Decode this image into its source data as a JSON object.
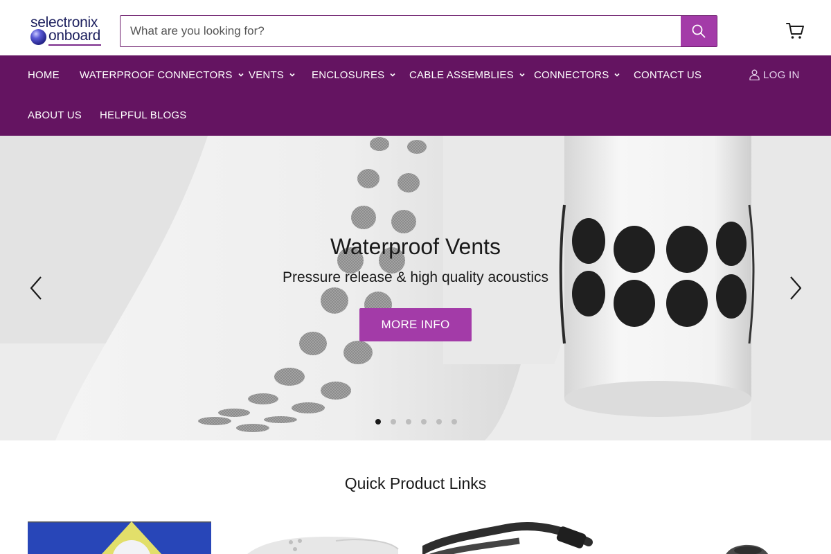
{
  "header": {
    "logo_top": "selectronix",
    "logo_bottom": "onboard",
    "search_placeholder": "What are you looking for?"
  },
  "nav": {
    "row1": [
      {
        "label": "HOME",
        "dropdown": false
      },
      {
        "label": "WATERPROOF CONNECTORS",
        "dropdown": true
      },
      {
        "label": "VENTS",
        "dropdown": true
      },
      {
        "label": "ENCLOSURES",
        "dropdown": true
      },
      {
        "label": "CABLE ASSEMBLIES",
        "dropdown": true
      },
      {
        "label": "CONNECTORS",
        "dropdown": true
      },
      {
        "label": "CONTACT US",
        "dropdown": false
      }
    ],
    "row2": [
      {
        "label": "ABOUT US",
        "dropdown": false
      },
      {
        "label": "HELPFUL BLOGS",
        "dropdown": false
      }
    ],
    "login_label": "LOG IN"
  },
  "hero": {
    "title": "Waterproof Vents",
    "subtitle": "Pressure release & high quality acoustics",
    "button_label": "MORE INFO",
    "slide_count": 6,
    "active_slide": 1
  },
  "quick_links": {
    "title": "Quick Product Links"
  },
  "colors": {
    "nav_bg": "#641461",
    "accent": "#a33ba8",
    "brand_text": "#1c1f5e"
  }
}
